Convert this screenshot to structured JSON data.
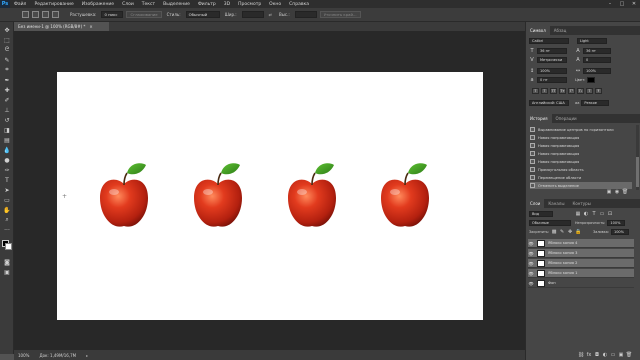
{
  "app": {
    "logo": "Ps"
  },
  "menu": [
    "Файл",
    "Редактирование",
    "Изображение",
    "Слои",
    "Текст",
    "Выделение",
    "Фильтр",
    "3D",
    "Просмотр",
    "Окно",
    "Справка"
  ],
  "window_controls": {
    "minimize": "–",
    "maximize": "□",
    "close": "✕"
  },
  "options": {
    "feather_label": "Растушевка:",
    "feather_value": "0 пикс",
    "smooth_label": "Сглаживание",
    "style_label": "Стиль:",
    "style_value": "Обычный",
    "width_label": "Шир.:",
    "height_label": "Выс.:",
    "refine_edge": "Уточнить край..."
  },
  "document": {
    "tab_title": "Без имени-1 @ 100% (RGB/8#) *",
    "tab_close": "×"
  },
  "status": {
    "zoom": "100%",
    "doc_size": "Док: 1,49M/16,7M"
  },
  "character_panel": {
    "tabs": [
      "Символ",
      "Абзац"
    ],
    "font_family": "Calibri",
    "font_style": "Light",
    "font_size": "36 пт",
    "leading": "36 пт",
    "kerning": "Метрически",
    "tracking": "0",
    "scale_v": "100%",
    "scale_h": "100%",
    "baseline": "0 пт",
    "color_label": "Цвет:",
    "color": "#000000",
    "style_buttons": [
      "T",
      "T",
      "TT",
      "Tт",
      "T¹",
      "T₁",
      "T",
      "Ŧ"
    ],
    "language": "Английский: США",
    "aa_mark": "aa",
    "aa_mode": "Резкое"
  },
  "history_panel": {
    "tabs": [
      "История",
      "Операции"
    ],
    "items": [
      "Выравнивание центров по горизонтали",
      "Новая направляющая",
      "Новая направляющая",
      "Новая направляющая",
      "Новая направляющая",
      "Прямоугольная область",
      "Перемещение области",
      "Отменить выделение"
    ],
    "selected_index": 7
  },
  "layers_panel": {
    "tabs": [
      "Слои",
      "Каналы",
      "Контуры"
    ],
    "filter_label": "Вид",
    "blend_mode": "Обычные",
    "opacity_label": "Непрозрачность:",
    "opacity": "100%",
    "lock_label": "Закрепить:",
    "fill_label": "Заливка:",
    "fill": "100%",
    "layers": [
      {
        "name": "Яблоко копия 4",
        "selected": true
      },
      {
        "name": "Яблоко копия 3",
        "selected": true
      },
      {
        "name": "Яблоко копия 2",
        "selected": true
      },
      {
        "name": "Яблоко копия 1",
        "selected": true
      },
      {
        "name": "Фон",
        "selected": false
      }
    ]
  },
  "colors": {
    "accent": "#31a8ff",
    "apple_red": "#d0321b",
    "leaf_green": "#3f9a22"
  }
}
